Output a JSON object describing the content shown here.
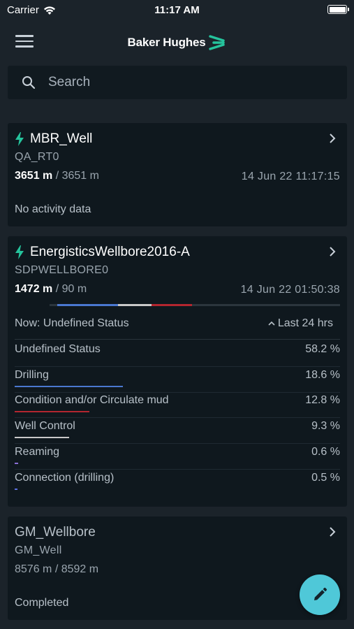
{
  "status_bar": {
    "carrier": "Carrier",
    "time": "11:17 AM"
  },
  "header": {
    "logo_text": "Baker Hughes",
    "menu_icon": "hamburger-menu-icon",
    "logo_mark_color": "#25c39c"
  },
  "search": {
    "placeholder": "Search",
    "value": ""
  },
  "colors": {
    "background": "#1b232a",
    "card": "#0f181e",
    "accent_green": "#25c39c",
    "fab": "#4fc8d8",
    "drilling": "#4a78d0",
    "circulate": "#b3262f",
    "well_control": "#c9c9c9",
    "undefined": "#2b353d"
  },
  "wells": [
    {
      "name": "MBR_Well",
      "live": true,
      "subtitle": "QA_RT0",
      "depth_current": "3651 m",
      "depth_total": "/ 3651 m",
      "date": "14 Jun 22 11:17:15",
      "activity_note": "No activity data"
    },
    {
      "name": "EnergisticsWellbore2016-A",
      "live": true,
      "subtitle": "SDPWELLBORE0",
      "depth_current": "1472 m",
      "depth_total": "/ 90 m",
      "date": "14 Jun 22 01:50:38",
      "now_label": "Now: Undefined Status",
      "range_label": "Last 24 hrs",
      "activities": [
        {
          "label": "Undefined Status",
          "percent": "58.2 %",
          "value": 58.2,
          "color": ""
        },
        {
          "label": "Drilling",
          "percent": "18.6 %",
          "value": 18.6,
          "color": "#4a78d0"
        },
        {
          "label": "Condition and/or Circulate mud",
          "percent": "12.8 %",
          "value": 12.8,
          "color": "#b3262f"
        },
        {
          "label": "Well Control",
          "percent": "9.3 %",
          "value": 9.3,
          "color": "#c9c9c9"
        },
        {
          "label": "Reaming",
          "percent": "0.6 %",
          "value": 0.6,
          "color": "#8a6fd6"
        },
        {
          "label": "Connection (drilling)",
          "percent": "0.5 %",
          "value": 0.5,
          "color": "#5a6fe0"
        }
      ]
    },
    {
      "name": "GM_Wellbore",
      "live": false,
      "subtitle": "GM_Well",
      "depth_text": "8576 m / 8592 m",
      "activity_note": "Completed"
    }
  ],
  "fab": {
    "icon": "pencil-edit-icon"
  }
}
